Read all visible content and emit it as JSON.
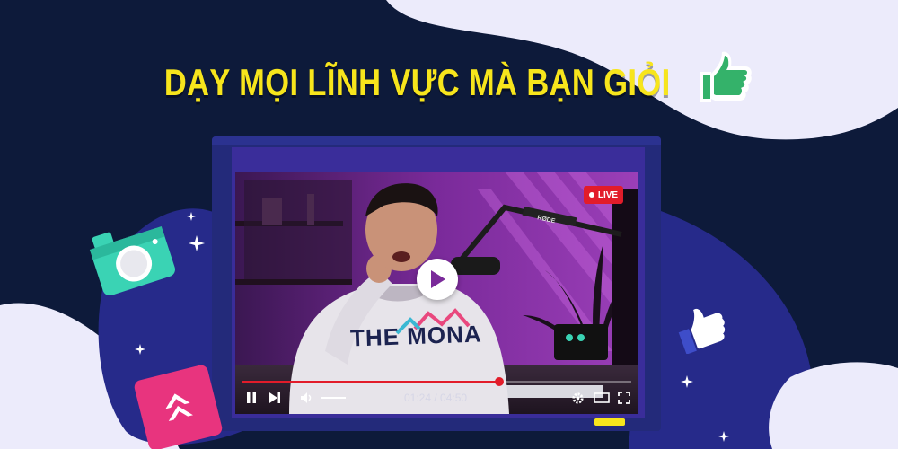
{
  "headline": "DẠY MỌI LĨNH VỰC MÀ BẠN GIỎI",
  "video": {
    "live_label": "LIVE",
    "shirt_print": "THE MONA",
    "mic_brand": "RØDE",
    "progress": 0.66,
    "current_time": "01:24",
    "duration": "04:50",
    "time_display": "01:24 / 04:50"
  },
  "colors": {
    "background": "#0d1a3a",
    "headline": "#f7e51c",
    "monitor": "#232a7a",
    "accent_red": "#e21c2a",
    "camera": "#3ad3b4",
    "pink_card": "#e8347e",
    "thumb_badge": "#34b26a"
  },
  "icons": {
    "controls": [
      "pause-icon",
      "next-icon",
      "volume-icon",
      "settings-icon",
      "theater-icon",
      "fullscreen-icon"
    ],
    "decorations": [
      "thumbs-up-badge-icon",
      "camera-icon",
      "pink-arrow-card-icon",
      "thumbs-up-outline-icon",
      "sparkle-icon"
    ]
  }
}
